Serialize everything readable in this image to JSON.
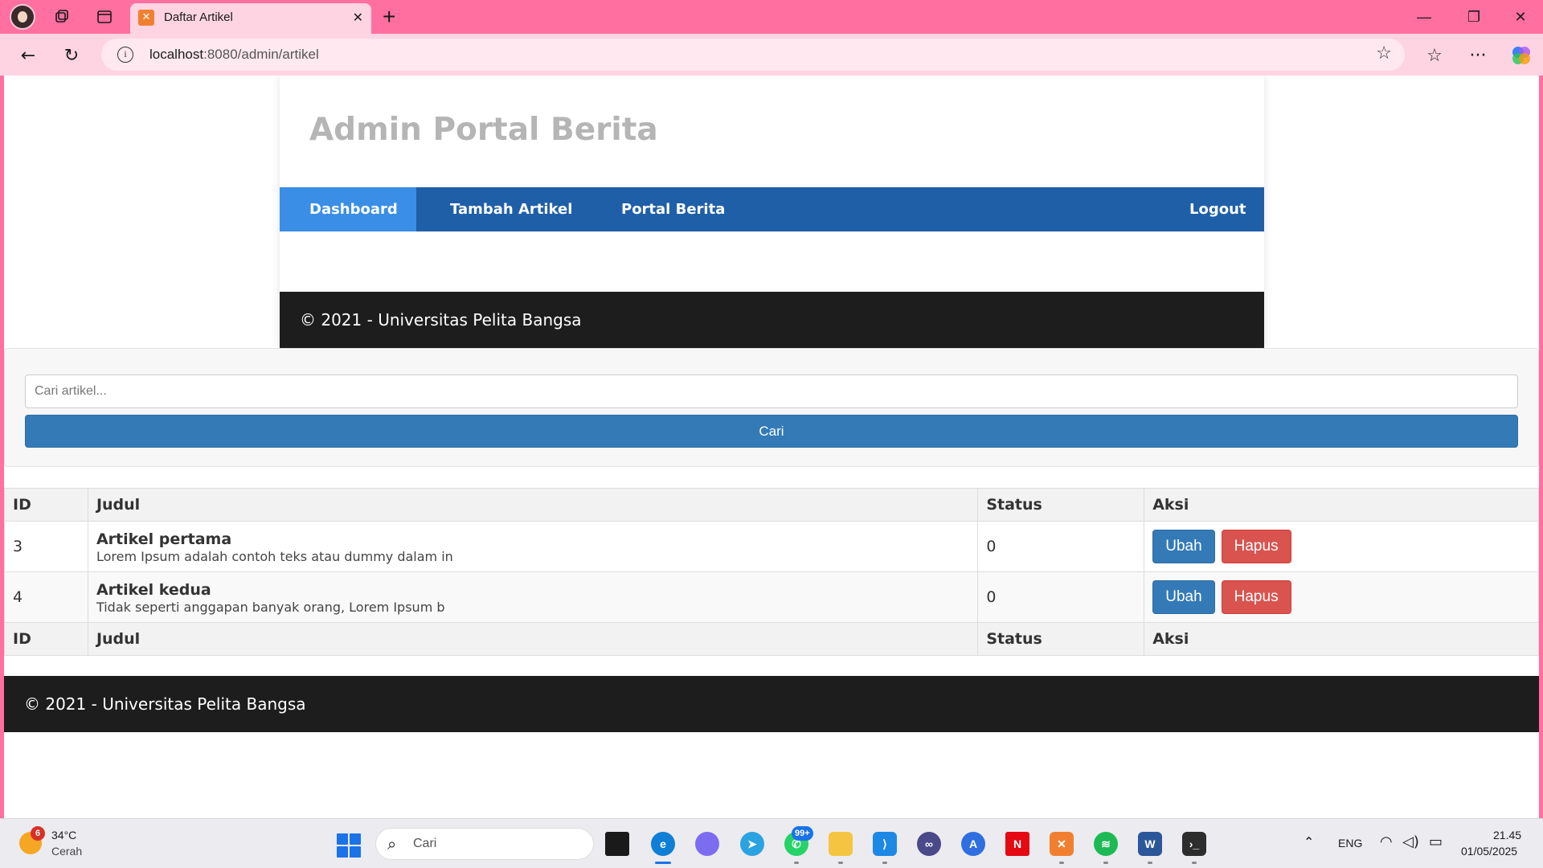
{
  "browser": {
    "tab_title": "Daftar Artikel",
    "url_host": "localhost",
    "url_rest": ":8080/admin/artikel"
  },
  "page": {
    "site_title": "Admin Portal Berita",
    "nav": {
      "dashboard": "Dashboard",
      "tambah": "Tambah Artikel",
      "portal": "Portal Berita",
      "logout": "Logout"
    },
    "footer": "© 2021 - Universitas Pelita Bangsa",
    "search": {
      "placeholder": "Cari artikel...",
      "button": "Cari"
    },
    "table": {
      "headers": [
        "ID",
        "Judul",
        "Status",
        "Aksi"
      ],
      "rows": [
        {
          "id": "3",
          "title": "Artikel pertama",
          "excerpt": "Lorem Ipsum adalah contoh teks atau dummy dalam in",
          "status": "0",
          "edit": "Ubah",
          "delete": "Hapus"
        },
        {
          "id": "4",
          "title": "Artikel kedua",
          "excerpt": "Tidak seperti anggapan banyak orang, Lorem Ipsum b",
          "status": "0",
          "edit": "Ubah",
          "delete": "Hapus"
        }
      ]
    },
    "footer_outer": "© 2021 - Universitas Pelita Bangsa"
  },
  "taskbar": {
    "weather_badge": "6",
    "weather_temp": "34°C",
    "weather_cond": "Cerah",
    "search_label": "Cari",
    "wa_badge": "99+",
    "lang": "ENG",
    "time": "21.45",
    "date": "01/05/2025"
  },
  "colors": {
    "nav_bg": "#1f5fa8",
    "nav_active": "#3a8ee6",
    "btn_primary": "#337ab7",
    "btn_danger": "#d9534f",
    "footer_bg": "#1d1d1d",
    "chrome_pink": "#ff6fa0"
  }
}
